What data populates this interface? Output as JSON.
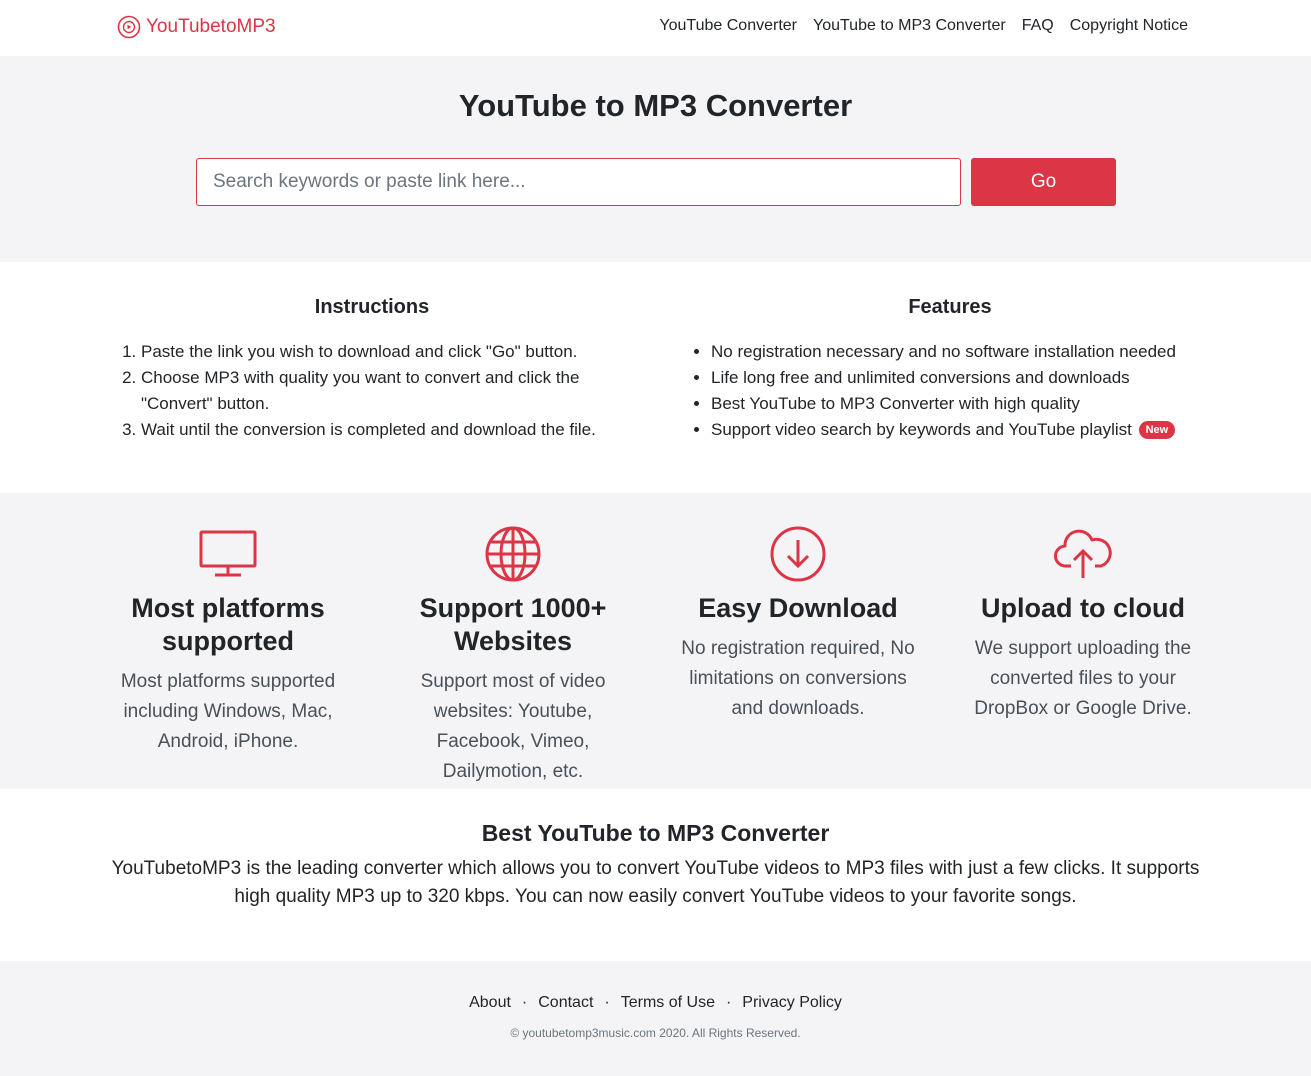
{
  "header": {
    "logo_text": "YouTubetoMP3",
    "nav": [
      {
        "label": "YouTube Converter"
      },
      {
        "label": "YouTube to MP3 Converter"
      },
      {
        "label": "FAQ"
      },
      {
        "label": "Copyright Notice"
      }
    ]
  },
  "hero": {
    "title": "YouTube to MP3 Converter",
    "search_placeholder": "Search keywords or paste link here...",
    "search_value": "",
    "go_label": "Go"
  },
  "instructions": {
    "title": "Instructions",
    "steps": [
      "Paste the link you wish to download and click \"Go\" button.",
      "Choose MP3 with quality you want to convert and click the \"Convert\" button.",
      "Wait until the conversion is completed and download the file."
    ]
  },
  "features": {
    "title": "Features",
    "items": [
      "No registration necessary and no software installation needed",
      "Life long free and unlimited conversions and downloads",
      "Best YouTube to MP3 Converter with high quality",
      "Support video search by keywords and YouTube playlist"
    ],
    "badge": "New"
  },
  "cards": [
    {
      "icon": "monitor-icon",
      "title": "Most platforms supported",
      "text": "Most platforms supported including Windows, Mac, Android, iPhone."
    },
    {
      "icon": "globe-icon",
      "title": "Support 1000+ Websites",
      "text": "Support most of video websites: Youtube, Facebook, Vimeo, Dailymotion, etc."
    },
    {
      "icon": "download-icon",
      "title": "Easy Download",
      "text": "No registration required, No limitations on conversions and downloads."
    },
    {
      "icon": "cloud-upload-icon",
      "title": "Upload to cloud",
      "text": "We support uploading the converted files to your DropBox or Google Drive."
    }
  ],
  "best": {
    "title": "Best YouTube to MP3 Converter",
    "text": "YouTubetoMP3 is the leading converter which allows you to convert YouTube videos to MP3 files with just a few clicks. It supports high quality MP3 up to 320 kbps. You can now easily convert YouTube videos to your favorite songs."
  },
  "footer": {
    "links": [
      {
        "label": "About"
      },
      {
        "label": "Contact"
      },
      {
        "label": "Terms of Use"
      },
      {
        "label": "Privacy Policy"
      }
    ],
    "separator": "·",
    "copyright": "© youtubetomp3music.com 2020. All Rights Reserved."
  },
  "colors": {
    "accent": "#dc3545",
    "section_bg": "#f4f4f6",
    "text": "#212529"
  }
}
